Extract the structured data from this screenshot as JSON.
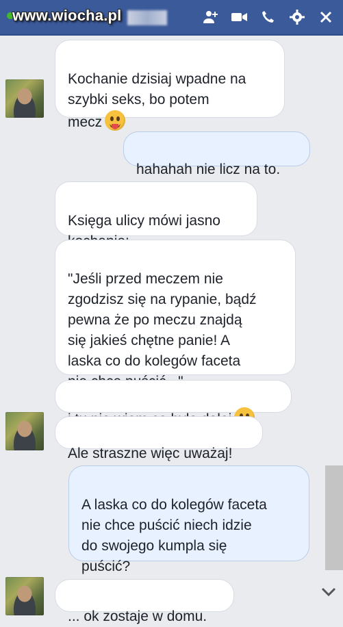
{
  "header": {
    "watermark": "www.wiocha.pl",
    "icons": [
      "add-friend-icon",
      "video-call-icon",
      "phone-icon",
      "gear-icon",
      "close-icon"
    ],
    "bar_color": "#3b5a9a"
  },
  "messages": [
    {
      "side": "in",
      "text": "Kochanie dzisiaj wpadne na\nszybki seks, bo  potem\nmecz",
      "emoji": "tongue-emoji"
    },
    {
      "side": "out",
      "text": "hahahah nie licz na to."
    },
    {
      "side": "in",
      "text": "Księga ulicy mówi jasno\nkochanie:"
    },
    {
      "side": "in",
      "text": "\"Jeśli przed meczem nie\nzgodzisz się na rypanie, bądź\npewna że po meczu znajdą\nsię jakieś chętne panie! A\nlaska co do kolegów faceta\nnie chce puścić...\""
    },
    {
      "side": "in",
      "text": "i tu nie wiem co było dalej",
      "emoji": "smile-emoji"
    },
    {
      "side": "in",
      "text": "Ale straszne więc uważaj!"
    },
    {
      "side": "out",
      "text": "A laska co do kolegów faceta\nnie chce puścić niech idzie\ndo swojego kumpla się\npuścić?"
    },
    {
      "side": "in",
      "text": "... ok zostaje w domu."
    }
  ],
  "colors": {
    "incoming": "#ffffff",
    "outgoing": "#e8f1ff",
    "background": "#e9ebee"
  }
}
